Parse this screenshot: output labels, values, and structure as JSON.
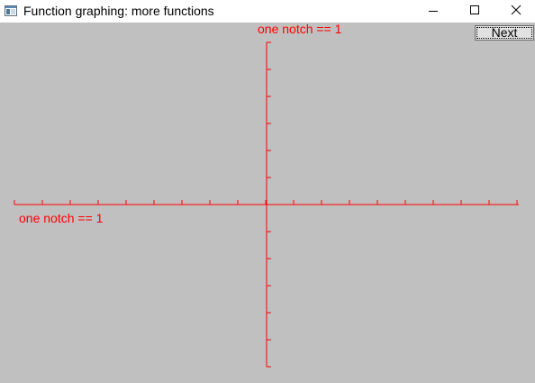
{
  "window": {
    "title": "Function graphing: more functions",
    "icon": "app-window-icon",
    "controls": {
      "minimize_icon": "minimize-icon",
      "maximize_icon": "maximize-icon",
      "close_icon": "close-icon"
    }
  },
  "toolbar": {
    "next_label": "Next"
  },
  "graph": {
    "axis_color": "#ff0000",
    "background": "#c0c0c0",
    "x_axis_label": "one notch == 1",
    "y_axis_label": "one notch == 1",
    "x_notch_count": 18,
    "y_notch_count": 11
  }
}
